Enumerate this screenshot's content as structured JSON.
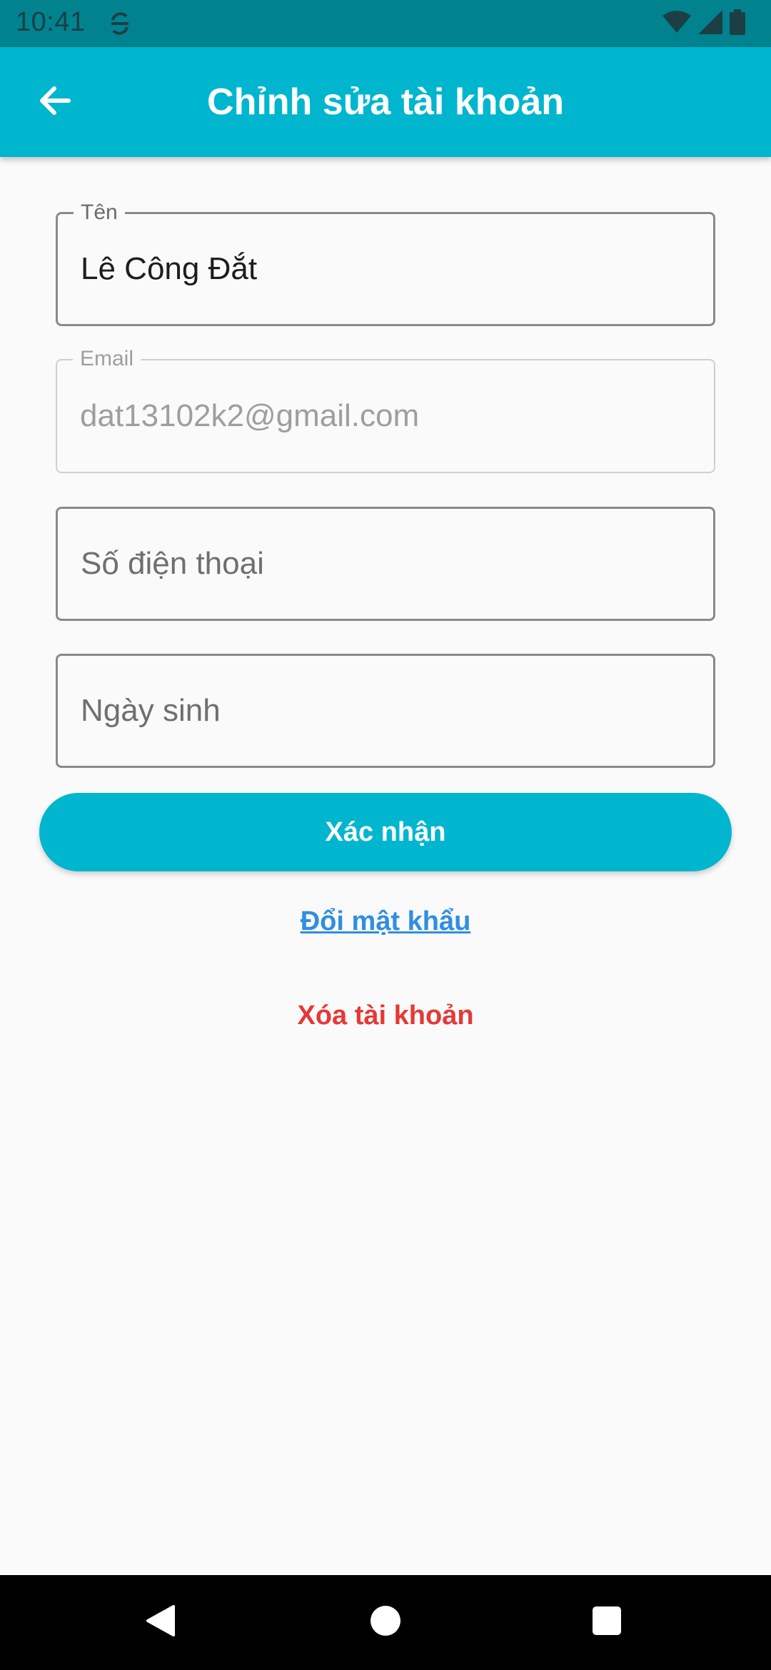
{
  "status_bar": {
    "time": "10:41",
    "icons": [
      "sync-icon",
      "wifi-icon",
      "signal-icon",
      "battery-icon"
    ]
  },
  "app_bar": {
    "title": "Chỉnh sửa tài khoản",
    "back_icon": "arrow-left-icon"
  },
  "form": {
    "name": {
      "label": "Tên",
      "value": "Lê Công Đắt"
    },
    "email": {
      "label": "Email",
      "value": "dat13102k2@gmail.com"
    },
    "phone": {
      "placeholder": "Số điện thoại"
    },
    "birthday": {
      "placeholder": "Ngày sinh"
    }
  },
  "actions": {
    "confirm_label": "Xác nhận",
    "change_password_label": "Đổi mật khẩu",
    "delete_account_label": "Xóa tài khoản"
  },
  "nav_bar": {
    "icons": [
      "back-triangle-icon",
      "home-circle-icon",
      "recents-square-icon"
    ]
  },
  "colors": {
    "status_bar": "#00838f",
    "primary": "#00b6cf",
    "link": "#2f8fe0",
    "danger": "#e53935",
    "background": "#fafafa"
  }
}
